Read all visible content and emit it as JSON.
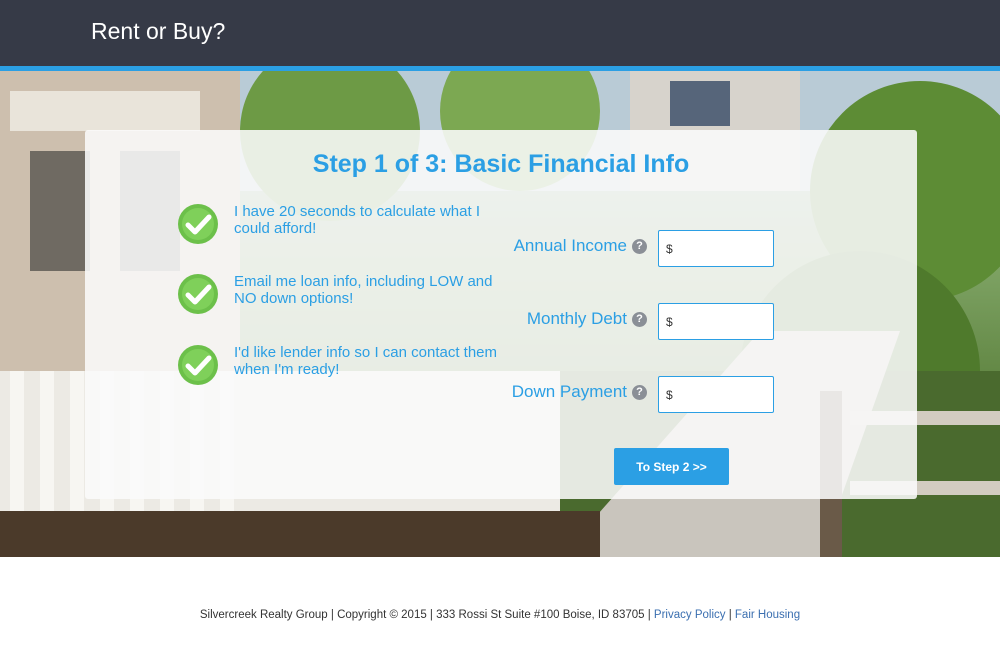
{
  "header": {
    "title": "Rent or Buy?"
  },
  "panel": {
    "title": "Step 1 of 3: Basic Financial Info",
    "bullets": [
      {
        "icon": "check-icon",
        "text": "I have 20 seconds to calculate what I could afford!"
      },
      {
        "icon": "check-icon",
        "text": "Email me loan info, including LOW and NO down options!"
      },
      {
        "icon": "check-icon",
        "text": "I'd like lender info so I can contact them when I'm ready!"
      }
    ],
    "fields": [
      {
        "label": "Annual Income",
        "prefix": "$",
        "value": ""
      },
      {
        "label": "Monthly Debt",
        "prefix": "$",
        "value": ""
      },
      {
        "label": "Down Payment",
        "prefix": "$",
        "value": ""
      }
    ],
    "help_glyph": "?",
    "next_button": "To Step 2 >>"
  },
  "footer": {
    "text": "Silvercreek Realty Group | Copyright © 2015 | 333 Rossi St Suite #100 Boise, ID 83705 |",
    "separator": "|",
    "privacy_link": "Privacy Policy",
    "fair_housing_link": "Fair Housing"
  },
  "colors": {
    "accent": "#2b9fe4",
    "header_bg": "#363a47",
    "check_green": "#6cc04a"
  }
}
